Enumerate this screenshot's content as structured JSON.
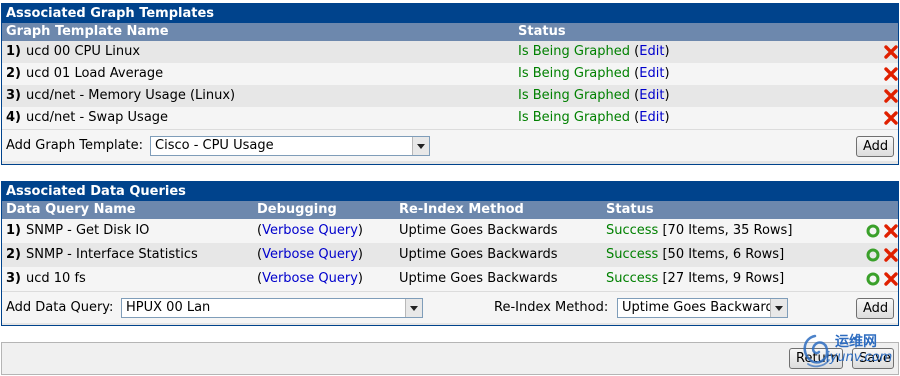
{
  "graph_templates": {
    "title": "Associated Graph Templates",
    "col_name": "Graph Template Name",
    "col_status": "Status",
    "rows": [
      {
        "num": "1)",
        "name": "ucd 00 CPU Linux",
        "status": "Is Being Graphed",
        "open": " (",
        "edit": "Edit",
        "close": ")"
      },
      {
        "num": "2)",
        "name": "ucd 01 Load Average",
        "status": "Is Being Graphed",
        "open": " (",
        "edit": "Edit",
        "close": ")"
      },
      {
        "num": "3)",
        "name": "ucd/net - Memory Usage (Linux)",
        "status": "Is Being Graphed",
        "open": " (",
        "edit": "Edit",
        "close": ")"
      },
      {
        "num": "4)",
        "name": "ucd/net - Swap Usage",
        "status": "Is Being Graphed",
        "open": " (",
        "edit": "Edit",
        "close": ")"
      }
    ],
    "add_label": "Add Graph Template:",
    "add_selected": "Cisco - CPU Usage",
    "add_button": "Add"
  },
  "data_queries": {
    "title": "Associated Data Queries",
    "col_name": "Data Query Name",
    "col_debug": "Debugging",
    "col_reindex": "Re-Index Method",
    "col_status": "Status",
    "rows": [
      {
        "num": "1)",
        "name": "SNMP - Get Disk IO",
        "open": "(",
        "debug": "Verbose Query",
        "close": ")",
        "reindex": "Uptime Goes Backwards",
        "status": "Success",
        "detail": " [70 Items, 35 Rows]"
      },
      {
        "num": "2)",
        "name": "SNMP - Interface Statistics",
        "open": "(",
        "debug": "Verbose Query",
        "close": ")",
        "reindex": "Uptime Goes Backwards",
        "status": "Success",
        "detail": " [50 Items, 6 Rows]"
      },
      {
        "num": "3)",
        "name": "ucd 10 fs",
        "open": "(",
        "debug": "Verbose Query",
        "close": ")",
        "reindex": "Uptime Goes Backwards",
        "status": "Success",
        "detail": " [27 Items, 9 Rows]"
      }
    ],
    "add_label": "Add Data Query:",
    "add_selected": "HPUX 00 Lan",
    "reindex_label": "Re-Index Method:",
    "reindex_selected": "Uptime Goes Backwards",
    "add_button": "Add"
  },
  "footer": {
    "return_button": "Return",
    "save_button": "Save"
  },
  "watermark": {
    "text": "运维网",
    "sub": "iyunv.com"
  },
  "colors": {
    "header": "#00438c",
    "subheader": "#6d88ad",
    "status_green": "#008000",
    "link": "#0000cc",
    "delete_red": "#e02000",
    "reload_green": "#3aa02a"
  },
  "icons": {
    "delete": "red-x-icon",
    "reload": "green-circle-icon"
  }
}
